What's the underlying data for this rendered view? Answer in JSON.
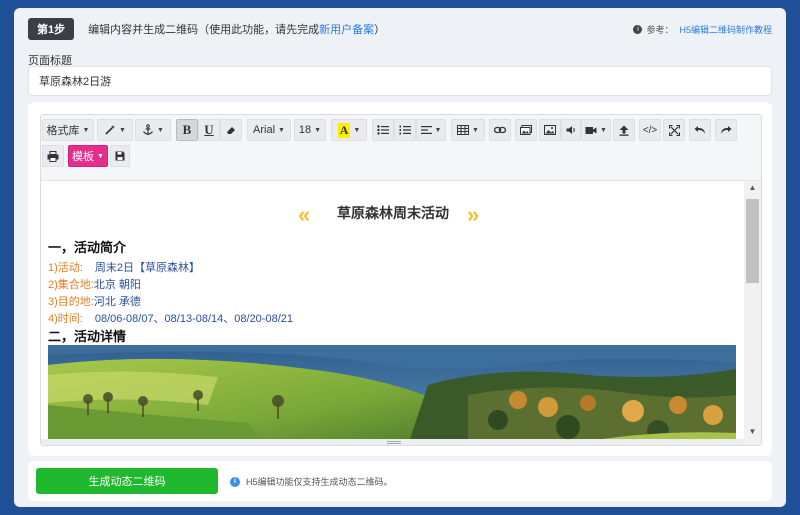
{
  "step": {
    "badge": "第1步",
    "text_prefix": "编辑内容并生成二维码（使用此功能，请先完成",
    "text_link": "新用户备案",
    "text_suffix": "）",
    "ref_label": "参考：",
    "ref_link": "H5编辑二维码制作教程"
  },
  "title_field": {
    "label": "页面标题",
    "value": "草原森林2日游"
  },
  "toolbar": {
    "format_label": "格式库",
    "font_family": "Arial",
    "font_size": "18",
    "bold_label": "B",
    "underline_label": "U",
    "template_label": "模板",
    "highlight_letter": "A",
    "code_label": "</>"
  },
  "document": {
    "title": "草原森林周末活动",
    "section1": "一，活动简介",
    "items": [
      {
        "key": "1)活动:",
        "value": "周末2日【草原森林】"
      },
      {
        "key": "2)集合地:",
        "value": "北京 朝阳"
      },
      {
        "key": "3)目的地:",
        "value": "河北 承德"
      },
      {
        "key": "4)时间:",
        "value": "08/06-08/07、08/13-08/14、08/20-08/21"
      }
    ],
    "section2": "二，活动详情"
  },
  "footer": {
    "button_label": "生成动态二维码",
    "note": "H5编辑功能仅支持生成动态二维码。"
  },
  "colors": {
    "background": "#1f4f97",
    "accent_green": "#1fb82e",
    "accent_pink": "#e52d8c",
    "link_blue": "#2a7ae2",
    "item_key_orange": "#e67e22"
  },
  "icons": [
    "info-icon",
    "magic-wand-icon",
    "anchor-icon",
    "eraser-icon",
    "unordered-list-icon",
    "ordered-list-icon",
    "align-icon",
    "table-icon",
    "link-icon",
    "image-gallery-icon",
    "image-icon",
    "audio-icon",
    "video-icon",
    "upload-icon",
    "code-icon",
    "fullscreen-icon",
    "undo-icon",
    "redo-icon",
    "print-icon",
    "save-icon"
  ]
}
